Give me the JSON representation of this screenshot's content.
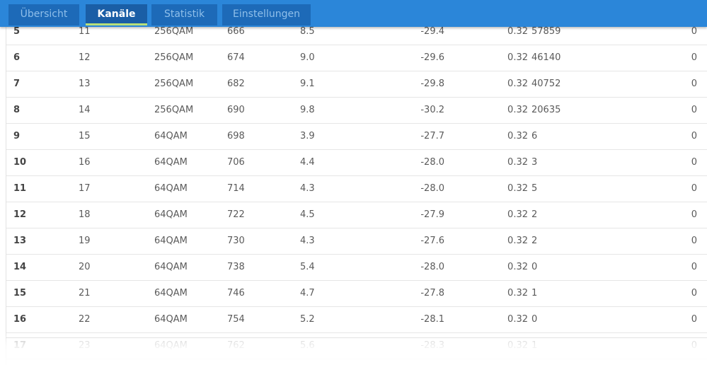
{
  "tabs": [
    {
      "label": "Übersicht",
      "active": false
    },
    {
      "label": "Kanäle",
      "active": true
    },
    {
      "label": "Statistik",
      "active": false
    },
    {
      "label": "Einstellungen",
      "active": false
    }
  ],
  "colors": {
    "tabbar_bg": "#2b86d9",
    "tab_bg": "#1d6ab8",
    "tab_active_underline": "#b9e07a"
  },
  "rows": [
    [
      "5",
      "11",
      "256QAM",
      "666",
      "8.5",
      "-29.4",
      "0.32",
      "57859",
      "0"
    ],
    [
      "6",
      "12",
      "256QAM",
      "674",
      "9.0",
      "-29.6",
      "0.32",
      "46140",
      "0"
    ],
    [
      "7",
      "13",
      "256QAM",
      "682",
      "9.1",
      "-29.8",
      "0.32",
      "40752",
      "0"
    ],
    [
      "8",
      "14",
      "256QAM",
      "690",
      "9.8",
      "-30.2",
      "0.32",
      "20635",
      "0"
    ],
    [
      "9",
      "15",
      "64QAM",
      "698",
      "3.9",
      "-27.7",
      "0.32",
      "6",
      "0"
    ],
    [
      "10",
      "16",
      "64QAM",
      "706",
      "4.4",
      "-28.0",
      "0.32",
      "3",
      "0"
    ],
    [
      "11",
      "17",
      "64QAM",
      "714",
      "4.3",
      "-28.0",
      "0.32",
      "5",
      "0"
    ],
    [
      "12",
      "18",
      "64QAM",
      "722",
      "4.5",
      "-27.9",
      "0.32",
      "2",
      "0"
    ],
    [
      "13",
      "19",
      "64QAM",
      "730",
      "4.3",
      "-27.6",
      "0.32",
      "2",
      "0"
    ],
    [
      "14",
      "20",
      "64QAM",
      "738",
      "5.4",
      "-28.0",
      "0.32",
      "0",
      "0"
    ],
    [
      "15",
      "21",
      "64QAM",
      "746",
      "4.7",
      "-27.8",
      "0.32",
      "1",
      "0"
    ],
    [
      "16",
      "22",
      "64QAM",
      "754",
      "5.2",
      "-28.1",
      "0.32",
      "0",
      "0"
    ],
    [
      "17",
      "23",
      "64QAM",
      "762",
      "5.6",
      "-28.3",
      "0.32",
      "1",
      "0"
    ]
  ]
}
